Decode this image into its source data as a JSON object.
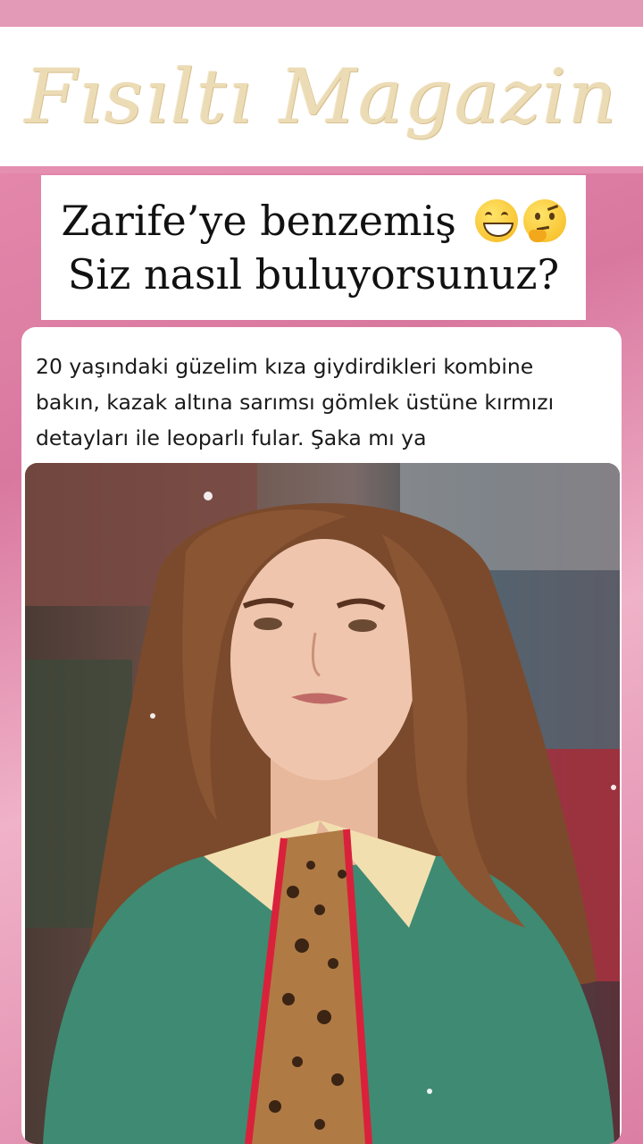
{
  "masthead": {
    "title": "Fısıltı Magazin"
  },
  "headline": {
    "line1": "Zarife’ye benzemiş",
    "line2": "Siz nasıl buluyorsunuz?",
    "emojis": [
      "grinning-face-icon",
      "thinking-face-icon"
    ]
  },
  "post": {
    "line1": "20 yaşındaki güzelim kıza giydirdikleri kombine",
    "line2": "bakın, kazak altına sarımsı gömlek üstüne kırmızı",
    "line3": "detayları ile leoparlı fular. Şaka mı ya",
    "photo": "woman-green-sweater-leopard-scarf-photo"
  },
  "colors": {
    "background_pink": "#e98fb0",
    "masthead_gold": "#ecdcb6",
    "sweater_green": "#3f8a72",
    "collar_cream": "#f2dfb0",
    "scarf_red": "#d9213b"
  }
}
